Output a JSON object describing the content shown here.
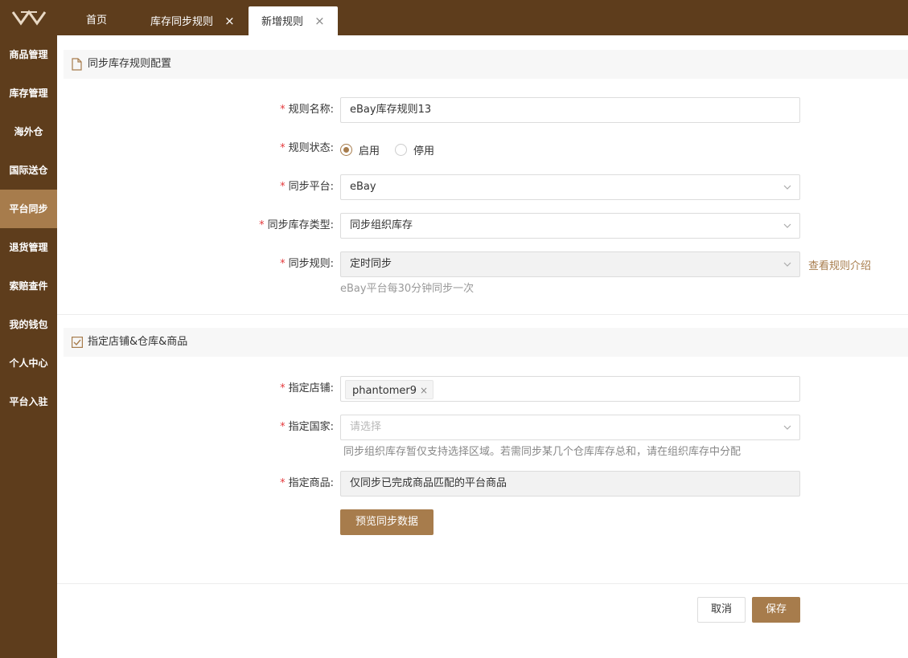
{
  "tabs": [
    {
      "label": "首页"
    },
    {
      "label": "库存同步规则",
      "close": "×"
    },
    {
      "label": "新增规则",
      "close": "×"
    }
  ],
  "sidebar": {
    "items": [
      {
        "label": "商品管理"
      },
      {
        "label": "库存管理"
      },
      {
        "label": "海外仓"
      },
      {
        "label": "国际送仓"
      },
      {
        "label": "平台同步"
      },
      {
        "label": "退货管理"
      },
      {
        "label": "索赔查件"
      },
      {
        "label": "我的钱包"
      },
      {
        "label": "个人中心"
      },
      {
        "label": "平台入驻"
      }
    ],
    "active_label": "平台同步"
  },
  "section1": {
    "title": "同步库存规则配置",
    "rule_name": {
      "label": "规则名称:",
      "value": "eBay库存规则13"
    },
    "rule_status": {
      "label": "规则状态:",
      "option_on": "启用",
      "option_off": "停用",
      "selected": "启用"
    },
    "platform": {
      "label": "同步平台:",
      "value": "eBay"
    },
    "stock_type": {
      "label": "同步库存类型:",
      "value": "同步组织库存"
    },
    "sync_rule": {
      "label": "同步规则:",
      "value": "定时同步",
      "link": "查看规则介绍",
      "hint": "eBay平台每30分钟同步一次"
    }
  },
  "section2": {
    "title": "指定店铺&仓库&商品",
    "shop": {
      "label": "指定店铺:",
      "tag": "phantomer9",
      "tag_close": "×"
    },
    "country": {
      "label": "指定国家:",
      "placeholder": "请选择",
      "hint": "同步组织库存暂仅支持选择区域。若需同步某几个仓库库存总和，请在组织库存中分配"
    },
    "product": {
      "label": "指定商品:",
      "value": "仅同步已完成商品匹配的平台商品"
    },
    "preview_button": "预览同步数据"
  },
  "footer": {
    "cancel": "取消",
    "save": "保存"
  },
  "colors": {
    "brand_dark": "#5e3d1c",
    "accent": "#a77c4c",
    "required": "#e4393c"
  },
  "icons": [
    "logo-icon",
    "close-icon",
    "document-icon",
    "checkbox-icon",
    "chevron-down-icon"
  ]
}
